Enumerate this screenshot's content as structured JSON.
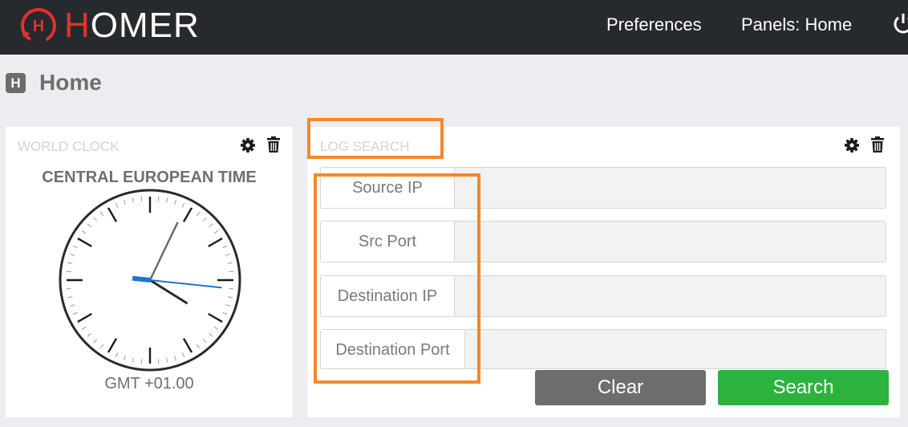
{
  "app": {
    "logo_letter": "H",
    "logo_rest": "OMER"
  },
  "nav": {
    "preferences": "Preferences",
    "panels": "Panels: Home"
  },
  "page": {
    "title": "Home",
    "title_icon_letter": "H"
  },
  "world_clock": {
    "title": "WORLD CLOCK",
    "timezone_name": "CENTRAL EUROPEAN TIME",
    "offset": "GMT +01.00",
    "time": {
      "hours": 4,
      "minutes": 4,
      "seconds": 16
    }
  },
  "log_search": {
    "title": "LOG SEARCH",
    "fields": [
      {
        "label": "Source IP",
        "value": ""
      },
      {
        "label": "Src Port",
        "value": ""
      },
      {
        "label": "Destination IP",
        "value": ""
      },
      {
        "label": "Destination Port",
        "value": ""
      }
    ],
    "clear_label": "Clear",
    "search_label": "Search"
  },
  "colors": {
    "accent": "#e3312b",
    "topbar": "#26292d",
    "search_button": "#2db33d",
    "clear_button": "#6d6d6d",
    "annotation": "#f5872d",
    "second_hand": "#1b73d6"
  },
  "icons": [
    "homer-logo-icon",
    "power-icon",
    "home-title-icon",
    "gear-icon",
    "trash-icon"
  ]
}
